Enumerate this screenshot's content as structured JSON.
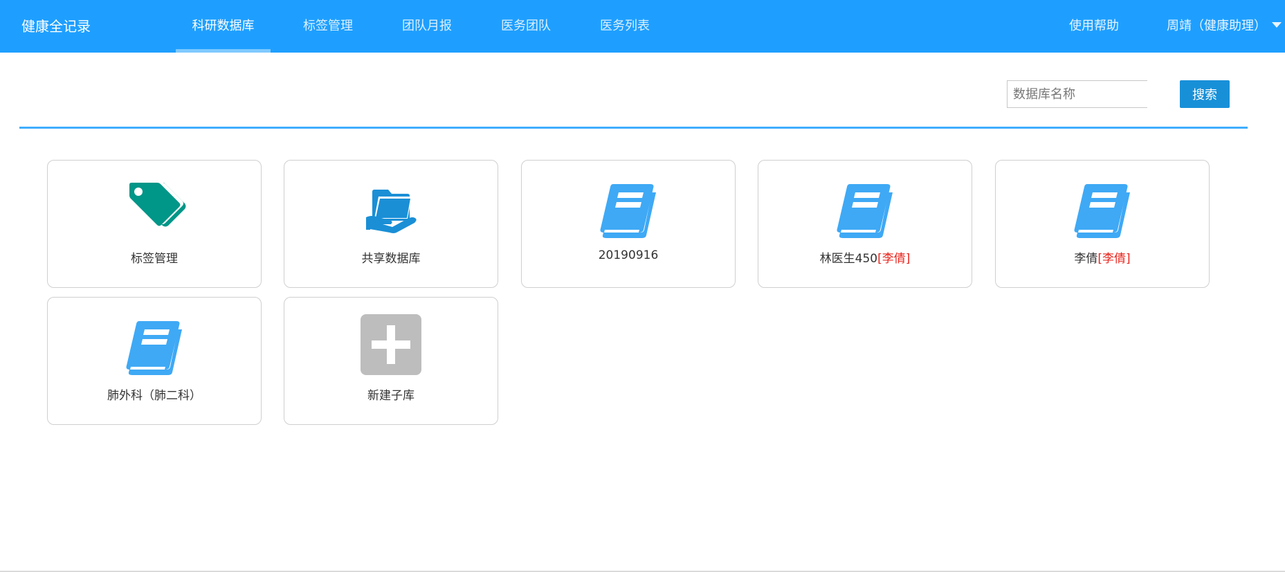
{
  "header": {
    "brand": "健康全记录",
    "nav": [
      {
        "label": "科研数据库",
        "active": true
      },
      {
        "label": "标签管理",
        "active": false
      },
      {
        "label": "团队月报",
        "active": false
      },
      {
        "label": "医务团队",
        "active": false
      },
      {
        "label": "医务列表",
        "active": false
      }
    ],
    "help": "使用帮助",
    "user": "周靖（健康助理）"
  },
  "search": {
    "placeholder": "数据库名称",
    "value": "",
    "button_label": "搜索"
  },
  "colors": {
    "primary": "#1e9fff",
    "search_button": "#1890d8",
    "tag_icon": "#009688",
    "book_icon": "#3fa9f5",
    "share_icon": "#1a8fd6",
    "add_icon_bg": "#bdbdbd",
    "owner_text": "#e8231b"
  },
  "cards": [
    {
      "name": "标签管理",
      "owner": "",
      "icon": "tag-icon"
    },
    {
      "name": "共享数据库",
      "owner": "",
      "icon": "shared-folder-icon"
    },
    {
      "name": "20190916",
      "owner": "",
      "icon": "book-icon"
    },
    {
      "name": "林医生450",
      "owner": "[李倩]",
      "icon": "book-icon"
    },
    {
      "name": "李倩",
      "owner": "[李倩]",
      "icon": "book-icon"
    },
    {
      "name": "肺外科（肺二科）",
      "owner": "",
      "icon": "book-icon"
    },
    {
      "name": "新建子库",
      "owner": "",
      "icon": "add-icon"
    }
  ]
}
